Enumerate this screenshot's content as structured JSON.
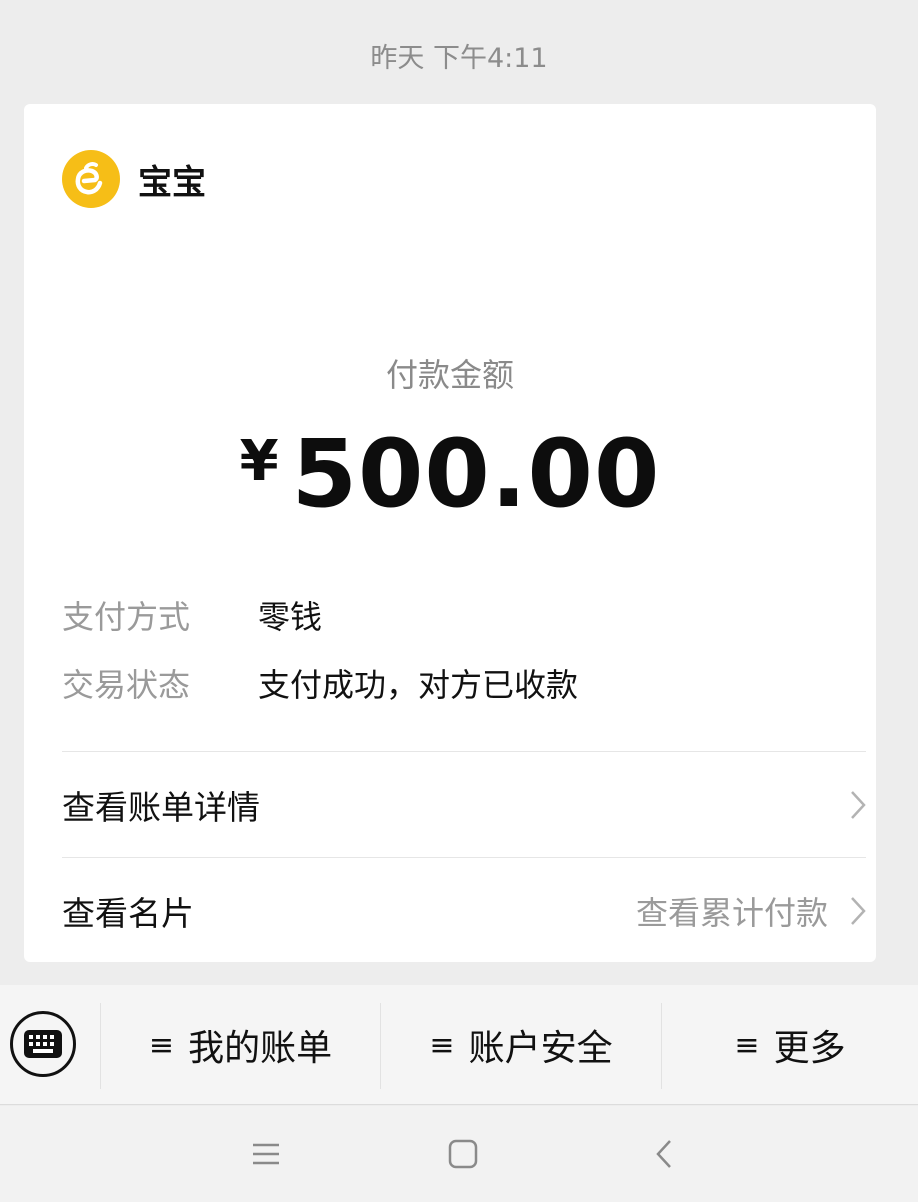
{
  "timestamp": "昨天 下午4:11",
  "merchant": {
    "name": "宝宝",
    "logo_icon": "merchant-logo-icon",
    "logo_color": "#f6be17"
  },
  "payment": {
    "amount_label": "付款金额",
    "currency": "¥",
    "amount": "500.00"
  },
  "details": [
    {
      "key": "支付方式",
      "value": "零钱"
    },
    {
      "key": "交易状态",
      "value": "支付成功，对方已收款"
    }
  ],
  "links": {
    "bill_details": {
      "label": "查看账单详情"
    },
    "business_card": {
      "label": "查看名片",
      "right_label": "查看累计付款"
    }
  },
  "menu": {
    "keyboard_icon": "keyboard-icon",
    "items": [
      {
        "label": "我的账单",
        "icon": "menu-icon"
      },
      {
        "label": "账户安全",
        "icon": "menu-icon"
      },
      {
        "label": "更多",
        "icon": "menu-icon"
      }
    ]
  },
  "navbar": {
    "buttons": [
      "menu-icon",
      "home-icon",
      "back-icon"
    ]
  }
}
